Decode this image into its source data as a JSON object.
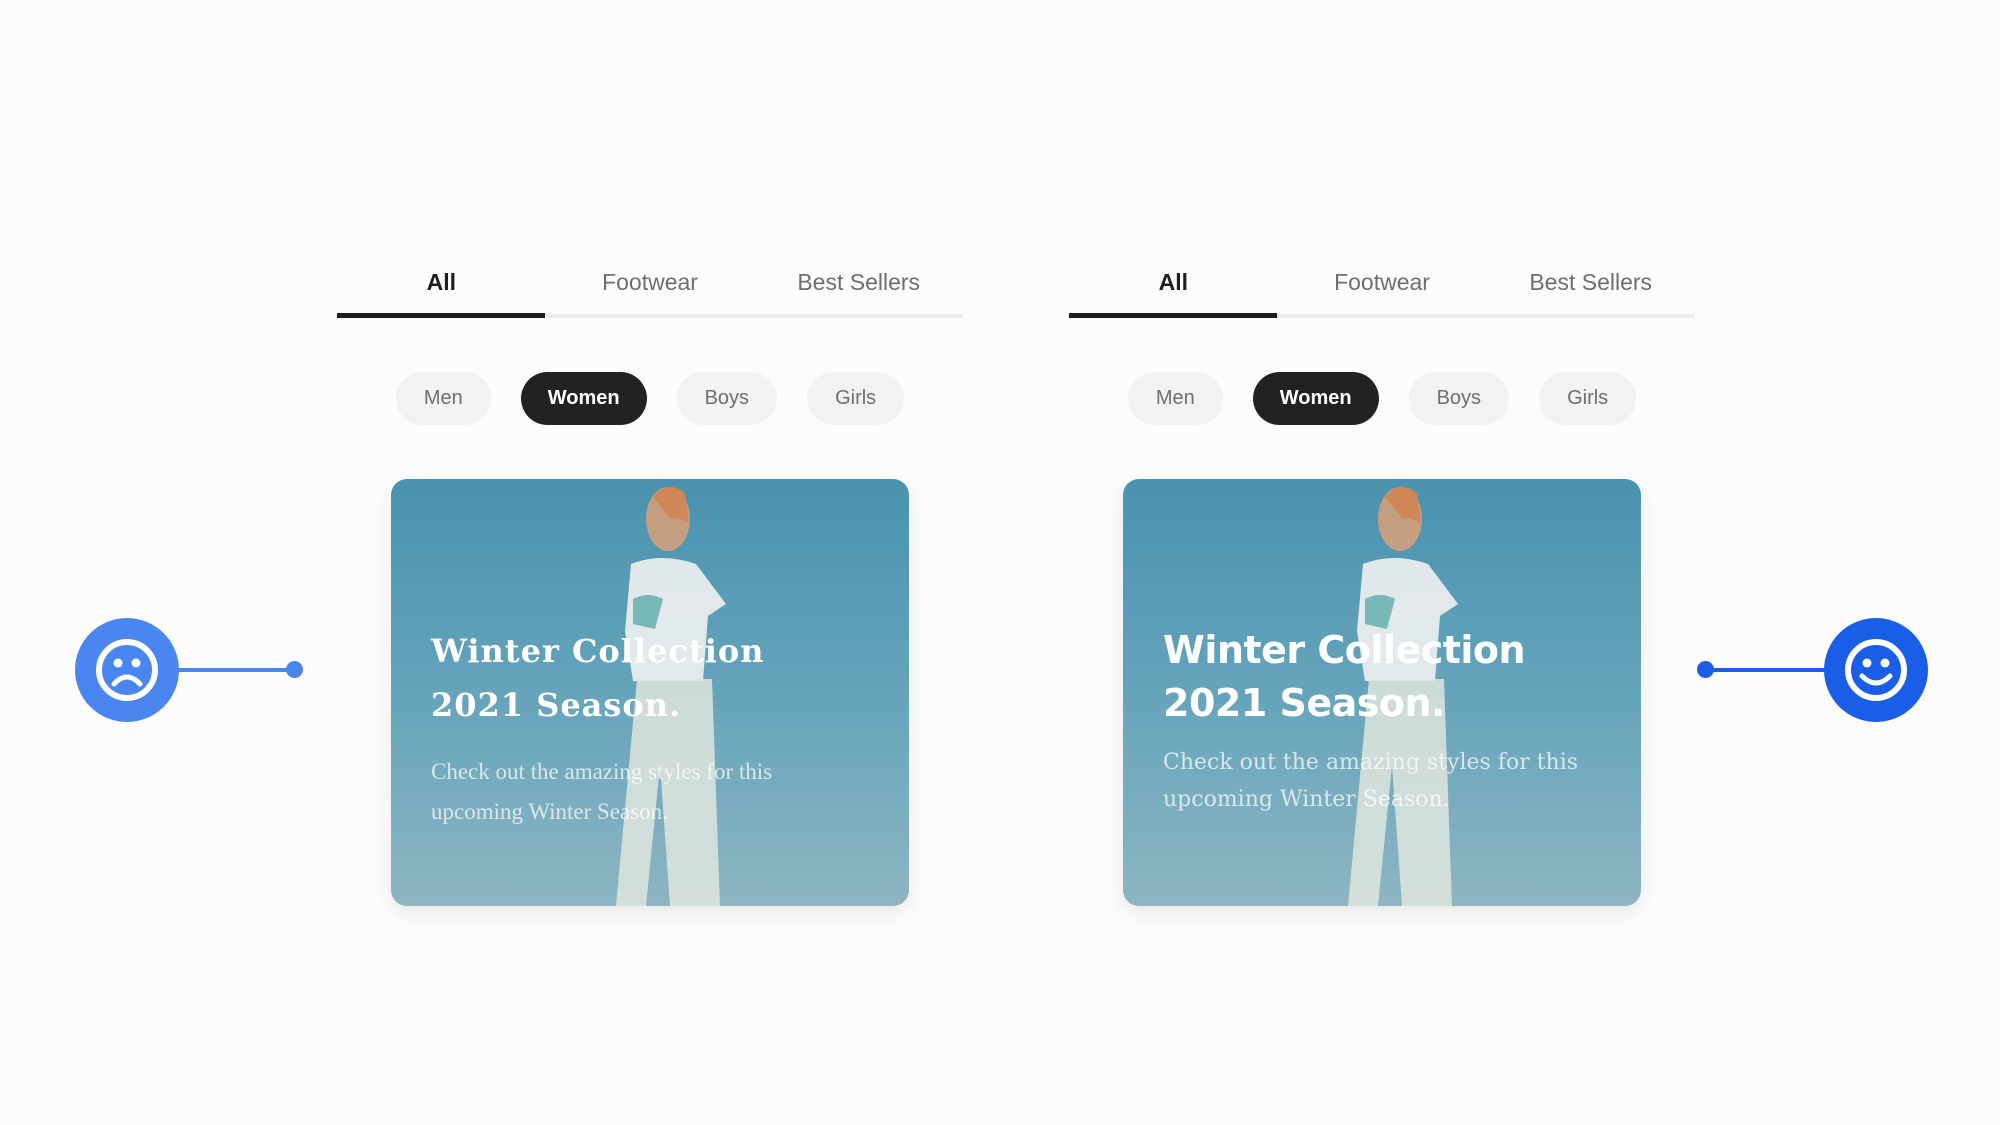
{
  "colors": {
    "sad": "#4a86ef",
    "happy": "#1a5ee8",
    "active": "#1e1e1e"
  },
  "variants": [
    {
      "tabs": [
        {
          "label": "All"
        },
        {
          "label": "Footwear"
        },
        {
          "label": "Best Sellers"
        }
      ],
      "active_tab": "All",
      "pills": [
        {
          "label": "Men"
        },
        {
          "label": "Women"
        },
        {
          "label": "Boys"
        },
        {
          "label": "Girls"
        }
      ],
      "active_pill": "Women",
      "card": {
        "title_line1": "Winter Collection",
        "title_line2": "2021 Season.",
        "subtitle": "Check out the amazing styles for this upcoming Winter Season."
      },
      "rating": {
        "icon": "sad-face-icon"
      }
    },
    {
      "tabs": [
        {
          "label": "All"
        },
        {
          "label": "Footwear"
        },
        {
          "label": "Best Sellers"
        }
      ],
      "active_tab": "All",
      "pills": [
        {
          "label": "Men"
        },
        {
          "label": "Women"
        },
        {
          "label": "Boys"
        },
        {
          "label": "Girls"
        }
      ],
      "active_pill": "Women",
      "card": {
        "title_line1": "Winter Collection",
        "title_line2": "2021 Season.",
        "subtitle": "Check out the amazing styles for this upcoming Winter Season."
      },
      "rating": {
        "icon": "happy-face-icon"
      }
    }
  ]
}
